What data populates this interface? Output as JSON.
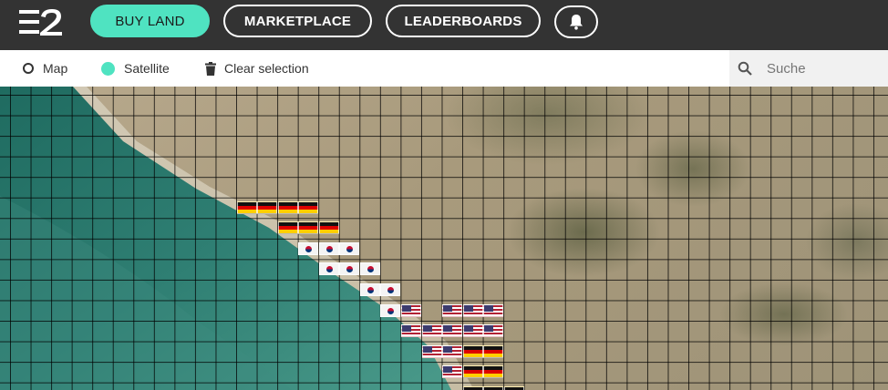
{
  "nav": {
    "buy_land": "BUY LAND",
    "marketplace": "MARKETPLACE",
    "leaderboards": "LEADERBOARDS"
  },
  "toolbar": {
    "map_label": "Map",
    "satellite_label": "Satellite",
    "clear_label": "Clear selection",
    "selected_view": "Satellite"
  },
  "search": {
    "placeholder": "Suche",
    "value": ""
  },
  "colors": {
    "accent": "#4fe3c1",
    "topbar": "#333333"
  },
  "map": {
    "tiles": [
      {
        "flag": "de",
        "col": 11,
        "row": 5
      },
      {
        "flag": "de",
        "col": 12,
        "row": 5
      },
      {
        "flag": "de",
        "col": 13,
        "row": 5
      },
      {
        "flag": "de",
        "col": 14,
        "row": 5
      },
      {
        "flag": "de",
        "col": 13,
        "row": 6
      },
      {
        "flag": "de",
        "col": 14,
        "row": 6
      },
      {
        "flag": "de",
        "col": 15,
        "row": 6
      },
      {
        "flag": "kr",
        "col": 14,
        "row": 7
      },
      {
        "flag": "kr",
        "col": 15,
        "row": 7
      },
      {
        "flag": "kr",
        "col": 16,
        "row": 7
      },
      {
        "flag": "kr",
        "col": 15,
        "row": 8
      },
      {
        "flag": "kr",
        "col": 16,
        "row": 8
      },
      {
        "flag": "kr",
        "col": 17,
        "row": 8
      },
      {
        "flag": "kr",
        "col": 17,
        "row": 9
      },
      {
        "flag": "kr",
        "col": 18,
        "row": 9
      },
      {
        "flag": "kr",
        "col": 18,
        "row": 10
      },
      {
        "flag": "us",
        "col": 19,
        "row": 10
      },
      {
        "flag": "us",
        "col": 21,
        "row": 10
      },
      {
        "flag": "us",
        "col": 22,
        "row": 10
      },
      {
        "flag": "us",
        "col": 23,
        "row": 10
      },
      {
        "flag": "us",
        "col": 19,
        "row": 11
      },
      {
        "flag": "us",
        "col": 20,
        "row": 11
      },
      {
        "flag": "us",
        "col": 21,
        "row": 11
      },
      {
        "flag": "us",
        "col": 22,
        "row": 11
      },
      {
        "flag": "us",
        "col": 23,
        "row": 11
      },
      {
        "flag": "us",
        "col": 20,
        "row": 12
      },
      {
        "flag": "us",
        "col": 21,
        "row": 12
      },
      {
        "flag": "de",
        "col": 22,
        "row": 12
      },
      {
        "flag": "de",
        "col": 23,
        "row": 12
      },
      {
        "flag": "us",
        "col": 21,
        "row": 13
      },
      {
        "flag": "de",
        "col": 22,
        "row": 13
      },
      {
        "flag": "de",
        "col": 23,
        "row": 13
      },
      {
        "flag": "de",
        "col": 22,
        "row": 14
      },
      {
        "flag": "de",
        "col": 23,
        "row": 14
      },
      {
        "flag": "de",
        "col": 24,
        "row": 14
      }
    ]
  }
}
